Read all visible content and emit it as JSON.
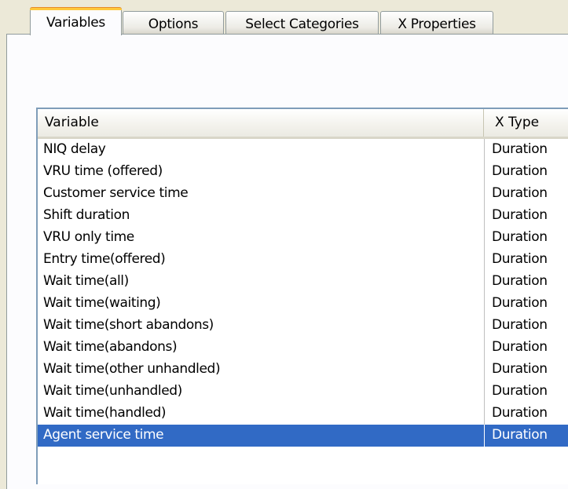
{
  "tabs": [
    {
      "label": "Variables",
      "active": true
    },
    {
      "label": "Options",
      "active": false
    },
    {
      "label": "Select Categories",
      "active": false
    },
    {
      "label": "X Properties",
      "active": false
    }
  ],
  "grid": {
    "columns": [
      "Variable",
      "X Type"
    ],
    "rows": [
      {
        "variable": "NIQ delay",
        "type": "Duration"
      },
      {
        "variable": "VRU time (offered)",
        "type": "Duration"
      },
      {
        "variable": "Customer service time",
        "type": "Duration"
      },
      {
        "variable": "Shift duration",
        "type": "Duration"
      },
      {
        "variable": "VRU only time",
        "type": "Duration"
      },
      {
        "variable": "Entry time(offered)",
        "type": "Duration"
      },
      {
        "variable": "Wait time(all)",
        "type": "Duration"
      },
      {
        "variable": "Wait time(waiting)",
        "type": "Duration"
      },
      {
        "variable": "Wait time(short abandons)",
        "type": "Duration"
      },
      {
        "variable": "Wait time(abandons)",
        "type": "Duration"
      },
      {
        "variable": "Wait time(other unhandled)",
        "type": "Duration"
      },
      {
        "variable": "Wait time(unhandled)",
        "type": "Duration"
      },
      {
        "variable": "Wait time(handled)",
        "type": "Duration"
      },
      {
        "variable": "Agent service time",
        "type": "Duration",
        "selected": true
      }
    ]
  },
  "colors": {
    "selection": "#316ac5",
    "active_tab_accent": "#ffc83c",
    "panel_border": "#919b9c",
    "grid_border": "#7f9db9"
  }
}
